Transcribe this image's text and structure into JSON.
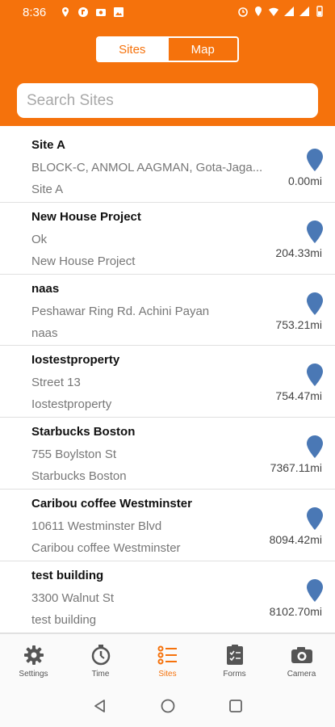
{
  "status_bar": {
    "time": "8:36"
  },
  "segmented": {
    "sites_label": "Sites",
    "map_label": "Map"
  },
  "search": {
    "placeholder": "Search Sites",
    "value": ""
  },
  "sites": [
    {
      "name": "Site A",
      "address": "BLOCK-C, ANMOL AAGMAN, Gota-Jaga...",
      "subtitle": "Site A",
      "distance": "0.00mi"
    },
    {
      "name": "New House Project",
      "address": "Ok",
      "subtitle": "New House Project",
      "distance": "204.33mi"
    },
    {
      "name": "naas",
      "address": "Peshawar Ring Rd. Achini Payan",
      "subtitle": "naas",
      "distance": "753.21mi"
    },
    {
      "name": "Iostestproperty",
      "address": "Street 13",
      "subtitle": "Iostestproperty",
      "distance": "754.47mi"
    },
    {
      "name": "Starbucks Boston",
      "address": "755 Boylston St",
      "subtitle": "Starbucks Boston",
      "distance": "7367.11mi"
    },
    {
      "name": "Caribou coffee Westminster",
      "address": "10611 Westminster Blvd",
      "subtitle": "Caribou coffee Westminster",
      "distance": "8094.42mi"
    },
    {
      "name": "test building",
      "address": "3300 Walnut St",
      "subtitle": "test building",
      "distance": "8102.70mi"
    }
  ],
  "bottom_nav": {
    "settings": "Settings",
    "time": "Time",
    "sites": "Sites",
    "forms": "Forms",
    "camera": "Camera"
  },
  "colors": {
    "accent": "#F5720C",
    "pin": "#4A78B5"
  }
}
